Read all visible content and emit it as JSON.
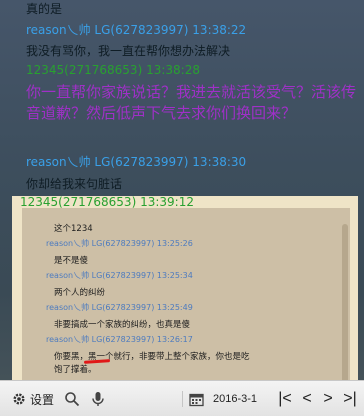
{
  "messages": {
    "m1_text": "真的是",
    "m2_header": "reason乀帅 LG(627823997) 13:38:22",
    "m2_text": "我没有骂你，我一直在帮你想办法解决",
    "m3_header": "12345(271768653) 13:38:28",
    "m3_text": "你一直帮你家族说话？我进去就活该受气？活该传音道歉？然后低声下气去求你们换回来？",
    "m4_header": "reason乀帅 LG(627823997) 13:38:30",
    "m4_text": "你却给我来句脏话",
    "m5_header": "12345(271768653) 13:39:12"
  },
  "quoted_screenshot": {
    "q1_text": "这个1234",
    "q2_header": "reason乀帅 LG(627823997) 13:25:26",
    "q2_text": "是不是傻",
    "q3_header": "reason乀帅 LG(627823997) 13:25:34",
    "q3_text": "两个人的纠纷",
    "q4_header": "reason乀帅 LG(627823997) 13:25:49",
    "q4_text": "非要搞成一个家族的纠纷，也真是傻",
    "q5_header": "reason乀帅 LG(627823997) 13:26:17",
    "q5_text1": "你要黑，黑一个就行，非要带上整个家族，你也是吃",
    "q5_text2": "饱了撑着。"
  },
  "toolbar": {
    "settings_label": "设置",
    "date": "2016-3-1"
  },
  "colors": {
    "other_user": "#3aa0e8",
    "self_user": "#28a030",
    "highlight_text": "#a030c8"
  }
}
